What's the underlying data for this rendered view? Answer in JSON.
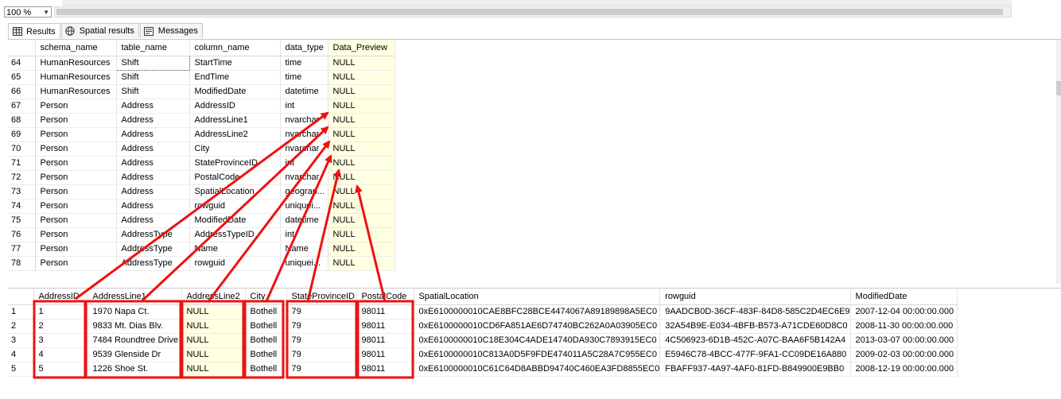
{
  "toolbar": {
    "zoom": "100 %"
  },
  "tabs": [
    {
      "label": "Results",
      "icon": "grid-icon",
      "active": true
    },
    {
      "label": "Spatial results",
      "icon": "globe-icon",
      "active": false
    },
    {
      "label": "Messages",
      "icon": "messages-icon",
      "active": false
    }
  ],
  "grid1": {
    "columns": [
      "schema_name",
      "table_name",
      "column_name",
      "data_type",
      "Data_Preview"
    ],
    "rows": [
      [
        "64",
        "HumanResources",
        "Shift",
        "StartTime",
        "time",
        "NULL"
      ],
      [
        "65",
        "HumanResources",
        "Shift",
        "EndTime",
        "time",
        "NULL"
      ],
      [
        "66",
        "HumanResources",
        "Shift",
        "ModifiedDate",
        "datetime",
        "NULL"
      ],
      [
        "67",
        "Person",
        "Address",
        "AddressID",
        "int",
        "NULL"
      ],
      [
        "68",
        "Person",
        "Address",
        "AddressLine1",
        "nvarchar",
        "NULL"
      ],
      [
        "69",
        "Person",
        "Address",
        "AddressLine2",
        "nvarchar",
        "NULL"
      ],
      [
        "70",
        "Person",
        "Address",
        "City",
        "nvarchar",
        "NULL"
      ],
      [
        "71",
        "Person",
        "Address",
        "StateProvinceID",
        "int",
        "NULL"
      ],
      [
        "72",
        "Person",
        "Address",
        "PostalCode",
        "nvarchar",
        "NULL"
      ],
      [
        "73",
        "Person",
        "Address",
        "SpatialLocation",
        "geograp...",
        "NULL"
      ],
      [
        "74",
        "Person",
        "Address",
        "rowguid",
        "uniquei...",
        "NULL"
      ],
      [
        "75",
        "Person",
        "Address",
        "ModifiedDate",
        "datetime",
        "NULL"
      ],
      [
        "76",
        "Person",
        "AddressType",
        "AddressTypeID",
        "int",
        "NULL"
      ],
      [
        "77",
        "Person",
        "AddressType",
        "Name",
        "Name",
        "NULL"
      ],
      [
        "78",
        "Person",
        "AddressType",
        "rowguid",
        "uniquei...",
        "NULL"
      ]
    ]
  },
  "grid2": {
    "columns": [
      "AddressID",
      "AddressLine1",
      "AddressLine2",
      "City",
      "StateProvinceID",
      "PostalCode",
      "SpatialLocation",
      "rowguid",
      "ModifiedDate"
    ],
    "rows": [
      [
        "1",
        "1",
        "1970 Napa Ct.",
        "NULL",
        "Bothell",
        "79",
        "98011",
        "0xE6100000010CAE8BFC28BCE4474067A89189898A5EC0",
        "9AADCB0D-36CF-483F-84D8-585C2D4EC6E9",
        "2007-12-04 00:00:00.000"
      ],
      [
        "2",
        "2",
        "9833 Mt. Dias Blv.",
        "NULL",
        "Bothell",
        "79",
        "98011",
        "0xE6100000010CD6FA851AE6D74740BC262A0A03905EC0",
        "32A54B9E-E034-4BFB-B573-A71CDE60D8C0",
        "2008-11-30 00:00:00.000"
      ],
      [
        "3",
        "3",
        "7484 Roundtree Drive",
        "NULL",
        "Bothell",
        "79",
        "98011",
        "0xE6100000010C18E304C4ADE14740DA930C7893915EC0",
        "4C506923-6D1B-452C-A07C-BAA6F5B142A4",
        "2013-03-07 00:00:00.000"
      ],
      [
        "4",
        "4",
        "9539 Glenside Dr",
        "NULL",
        "Bothell",
        "79",
        "98011",
        "0xE6100000010C813A0D5F9FDE474011A5C28A7C955EC0",
        "E5946C78-4BCC-477F-9FA1-CC09DE16A880",
        "2009-02-03 00:00:00.000"
      ],
      [
        "5",
        "5",
        "1226 Shoe St.",
        "NULL",
        "Bothell",
        "79",
        "98011",
        "0xE6100000010C61C64D8ABBD94740C460EA3FD8855EC0",
        "FBAFF937-4A97-4AF0-81FD-B849900E9BB0",
        "2008-12-19 00:00:00.000"
      ]
    ]
  },
  "annotation_color": "#ee1111"
}
